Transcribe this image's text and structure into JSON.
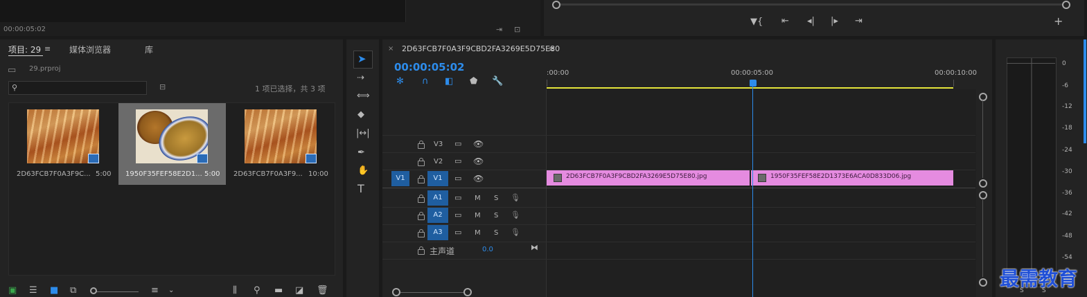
{
  "source_monitor": {
    "timecode": "00:00:05:02"
  },
  "project_panel": {
    "tabs": [
      {
        "label": "项目: 29"
      },
      {
        "label": "媒体浏览器"
      },
      {
        "label": "库"
      }
    ],
    "project_file": "29.prproj",
    "selection_status": "1 项已选择，共 3 项",
    "search_placeholder": "",
    "items": [
      {
        "name": "2D63FCB7F0A3F9C...",
        "duration": "5:00"
      },
      {
        "name": "1950F35FEF58E2D1...",
        "duration": "5:00"
      },
      {
        "name": "2D63FCB7F0A3F9...",
        "duration": "10:00"
      }
    ]
  },
  "timeline": {
    "sequence_name": "2D63FCB7F0A3F9CBD2FA3269E5D75E80",
    "timecode": "00:00:05:02",
    "ruler_labels": [
      ":00:00",
      "00:00:05:00",
      "00:00:10:00"
    ],
    "tracks": {
      "video": [
        {
          "label": "V3"
        },
        {
          "label": "V2"
        },
        {
          "label": "V1",
          "source": "V1"
        }
      ],
      "audio": [
        {
          "label": "A1",
          "m": "M",
          "s": "S"
        },
        {
          "label": "A2",
          "m": "M",
          "s": "S"
        },
        {
          "label": "A3",
          "m": "M",
          "s": "S"
        }
      ],
      "master": {
        "label": "主声道",
        "value": "0.0"
      }
    },
    "clips": [
      {
        "name": "2D63FCB7F0A3F9CBD2FA3269E5D75E80.jpg"
      },
      {
        "name": "1950F35FEF58E2D1373E6ACA0D833D06.jpg"
      }
    ]
  },
  "audio_meter": {
    "scale": [
      "0",
      "-6",
      "-12",
      "-18",
      "-24",
      "-30",
      "-36",
      "-42",
      "-48",
      "-54"
    ],
    "solo_labels": [
      "S",
      "S"
    ]
  },
  "watermark": "最需教育",
  "colors": {
    "accent": "#2d8ceb",
    "clip": "#e58be0",
    "work_area": "#e5e53a",
    "track_target": "#1f5ea0"
  }
}
